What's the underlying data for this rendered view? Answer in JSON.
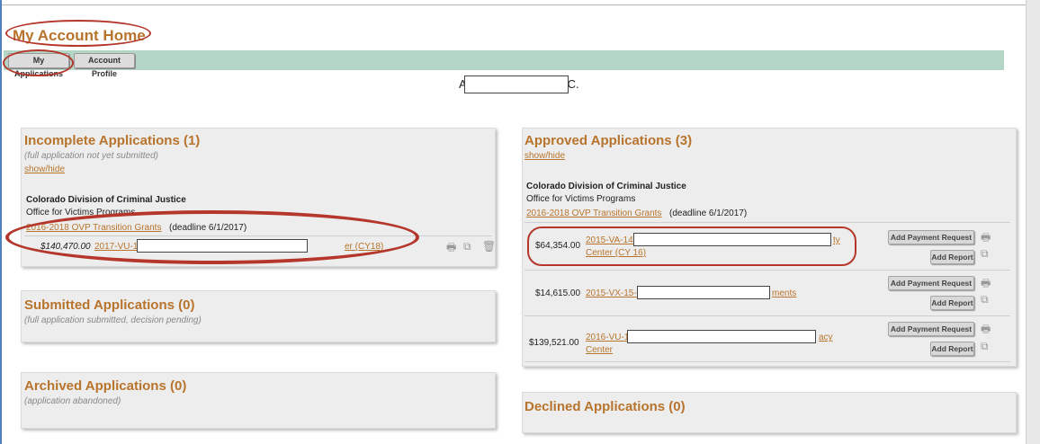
{
  "page": {
    "title": "My Account Home"
  },
  "tabs": [
    {
      "label": "My Applications"
    },
    {
      "label": "Account Profile"
    }
  ],
  "org": {
    "prefix": "A",
    "suffix": "C."
  },
  "incomplete": {
    "heading": "Incomplete Applications (1)",
    "subtitle": "(full application not yet submitted)",
    "toggle": "show/hide",
    "agency": "Colorado Division of Criminal Justice",
    "office": "Office for Victims Programs",
    "program_link": "2016-2018 OVP Transition Grants",
    "deadline": "(deadline 6/1/2017)",
    "rows": [
      {
        "amount": "$140,470.00",
        "link_prefix": "2017-VU-1",
        "link_suffix": "er (CY18)"
      }
    ]
  },
  "approved": {
    "heading": "Approved Applications (3)",
    "toggle": "show/hide",
    "agency": "Colorado Division of Criminal Justice",
    "office": "Office for Victims Programs",
    "program_link": "2016-2018 OVP Transition Grants",
    "deadline": "(deadline 6/1/2017)",
    "payment_button": "Add Payment Request",
    "report_button": "Add Report",
    "rows": [
      {
        "amount": "$64,354.00",
        "link_prefix": "2015-VA-14-",
        "link_suffix": "ty",
        "link_line2": "Center (CY 16)"
      },
      {
        "amount": "$14,615.00",
        "link_prefix": "2015-VX-15-",
        "link_suffix": "ments",
        "link_line2": ""
      },
      {
        "amount": "$139,521.00",
        "link_prefix": "2016-VU-1",
        "link_suffix": "acy",
        "link_line2": "Center"
      }
    ]
  },
  "submitted": {
    "heading": "Submitted Applications (0)",
    "subtitle": "(full application submitted, decision pending)"
  },
  "archived": {
    "heading": "Archived Applications (0)",
    "subtitle": "(application abandoned)"
  },
  "declined": {
    "heading": "Declined Applications (0)"
  },
  "colors": {
    "accent": "#b8742c",
    "tabbar": "#b4d6c6",
    "highlight": "#b5372c"
  },
  "icons": {
    "print": "print-icon",
    "copy": "copy-icon",
    "delete": "trash-icon"
  }
}
